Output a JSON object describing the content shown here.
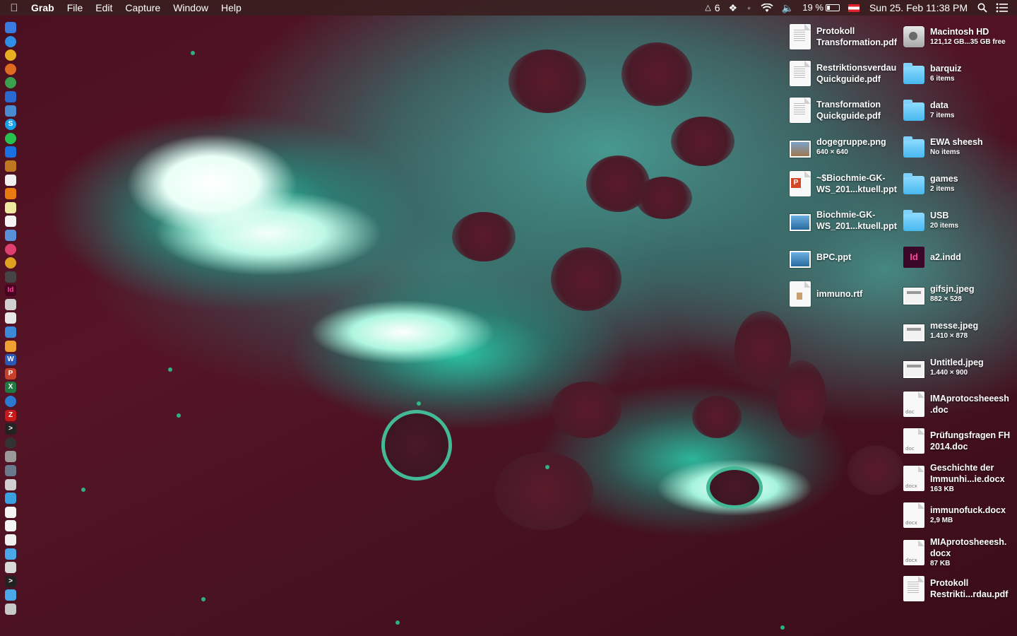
{
  "menubar": {
    "apple_icon": "apple-logo",
    "app_name": "Grab",
    "menus": [
      "File",
      "Edit",
      "Capture",
      "Window",
      "Help"
    ],
    "status": {
      "notification_count": "6",
      "battery_percent": "19 %",
      "datetime": "Sun 25. Feb  11:38 PM"
    }
  },
  "dock": {
    "icons": [
      "finder-icon",
      "safari-icon",
      "chrome-icon",
      "firefox-icon",
      "globe-icon",
      "onedrive-icon",
      "preview-icon",
      "skype-icon",
      "whatsapp-icon",
      "dropbox-icon",
      "ibooks-icon",
      "calendar-icon",
      "vlc-icon",
      "notes-icon",
      "textedit-icon",
      "mail-icon",
      "itunes-icon",
      "photos-icon",
      "pen-icon",
      "indesign-icon",
      "script-icon",
      "chart-icon",
      "keynote-icon",
      "pages-icon",
      "word-icon",
      "powerpoint-icon",
      "excel-icon",
      "thunderbird-icon",
      "filezilla-icon",
      "terminal-icon",
      "console-icon",
      "disk-utility-icon",
      "scanner-icon",
      "printer-icon",
      "downloads-folder-icon",
      "document-icon",
      "document2-icon",
      "document3-icon",
      "folder-icon",
      "stack-icon",
      "terminal2-icon",
      "folder2-icon",
      "trash-icon"
    ]
  },
  "desktop": {
    "left_column": [
      {
        "name": "Protokoll\nTransformation.pdf",
        "info": "",
        "icon": "pdf-document-icon"
      },
      {
        "name": "Restriktionsverdau\nQuickguide.pdf",
        "info": "",
        "icon": "pdf-document-icon"
      },
      {
        "name": "Transformation\nQuickguide.pdf",
        "info": "",
        "icon": "pdf-document-icon"
      },
      {
        "name": "dogegruppe.png",
        "info": "640 × 640",
        "icon": "image-icon"
      },
      {
        "name": "~$Biochmie-GK-\nWS_201...ktuell.ppt",
        "info": "",
        "icon": "powerpoint-file-icon"
      },
      {
        "name": "Biochmie-GK-\nWS_201...ktuell.ppt",
        "info": "",
        "icon": "presentation-icon"
      },
      {
        "name": "BPC.ppt",
        "info": "",
        "icon": "presentation-icon"
      },
      {
        "name": "immuno.rtf",
        "info": "",
        "icon": "rtf-document-icon"
      }
    ],
    "right_column": [
      {
        "name": "Macintosh HD",
        "info": "121,12 GB...35 GB free",
        "icon": "hard-drive-icon"
      },
      {
        "name": "barquiz",
        "info": "6 items",
        "icon": "folder-icon"
      },
      {
        "name": "data",
        "info": "7 items",
        "icon": "folder-icon"
      },
      {
        "name": "EWA sheesh",
        "info": "No items",
        "icon": "folder-icon"
      },
      {
        "name": "games",
        "info": "2 items",
        "icon": "folder-icon"
      },
      {
        "name": "USB",
        "info": "20 items",
        "icon": "folder-icon"
      },
      {
        "name": "a2.indd",
        "info": "",
        "icon": "indesign-file-icon"
      },
      {
        "name": "gifsjn.jpeg",
        "info": "882 × 528",
        "icon": "image-icon"
      },
      {
        "name": "messe.jpeg",
        "info": "1.410 × 878",
        "icon": "image-icon"
      },
      {
        "name": "Untitled.jpeg",
        "info": "1.440 × 900",
        "icon": "image-icon"
      },
      {
        "name": "IMAprotocsheeesh\n.doc",
        "info": "",
        "icon": "doc-file-icon"
      },
      {
        "name": "Prüfungsfragen FH\n2014.doc",
        "info": "",
        "icon": "doc-file-icon"
      },
      {
        "name": "Geschichte der\nImmunhi...ie.docx",
        "info": "163 KB",
        "icon": "docx-file-icon"
      },
      {
        "name": "immunofuck.docx",
        "info": "2,9 MB",
        "icon": "docx-file-icon"
      },
      {
        "name": "MIAprotosheeesh.\ndocx",
        "info": "87 KB",
        "icon": "docx-file-icon"
      },
      {
        "name": "Protokoll\nRestrikti...rdau.pdf",
        "info": "",
        "icon": "pdf-document-icon"
      }
    ]
  }
}
